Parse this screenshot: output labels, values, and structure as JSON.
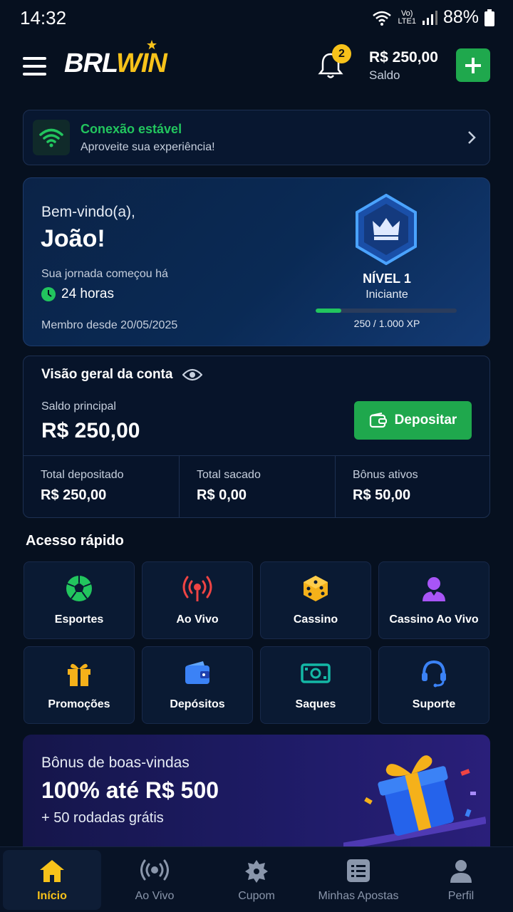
{
  "status_bar": {
    "time": "14:32",
    "volte_top": "Vo)",
    "volte_bottom": "LTE1",
    "battery": "88%"
  },
  "header": {
    "logo_brl": "BRL",
    "logo_win": "WIN",
    "notification_count": "2",
    "balance": "R$ 250,00",
    "balance_label": "Saldo"
  },
  "connection": {
    "title": "Conexão estável",
    "subtitle": "Aproveite sua experiência!"
  },
  "welcome": {
    "greeting": "Bem-vindo(a),",
    "name": "João!",
    "journey_label": "Sua jornada começou há",
    "journey_time": "24 horas",
    "member_since": "Membro desde 20/05/2025",
    "level_title": "NÍVEL 1",
    "level_name": "Iniciante",
    "xp_text": "250 / 1.000 XP",
    "xp_progress": 0.18
  },
  "account": {
    "title": "Visão geral da conta",
    "main_label": "Saldo principal",
    "main_value": "R$ 250,00",
    "deposit_label": "Depositar",
    "stats": [
      {
        "label": "Total depositado",
        "value": "R$ 250,00"
      },
      {
        "label": "Total sacado",
        "value": "R$ 0,00"
      },
      {
        "label": "Bônus ativos",
        "value": "R$ 50,00"
      }
    ]
  },
  "quick_access": {
    "title": "Acesso rápido",
    "items": [
      {
        "label": "Esportes",
        "icon": "soccer-ball-icon"
      },
      {
        "label": "Ao Vivo",
        "icon": "live-broadcast-icon"
      },
      {
        "label": "Cassino",
        "icon": "dice-icon"
      },
      {
        "label": "Cassino Ao Vivo",
        "icon": "dealer-icon"
      },
      {
        "label": "Promoções",
        "icon": "gift-icon"
      },
      {
        "label": "Depósitos",
        "icon": "wallet-icon"
      },
      {
        "label": "Saques",
        "icon": "cash-icon"
      },
      {
        "label": "Suporte",
        "icon": "headset-icon"
      }
    ]
  },
  "bonus": {
    "subtitle": "Bônus de boas-vindas",
    "title": "100% até R$ 500",
    "extra": "+ 50 rodadas grátis"
  },
  "bottom_nav": {
    "items": [
      {
        "label": "Início",
        "icon": "home-icon",
        "active": true
      },
      {
        "label": "Ao Vivo",
        "icon": "live-icon",
        "active": false
      },
      {
        "label": "Cupom",
        "icon": "coupon-icon",
        "active": false
      },
      {
        "label": "Minhas Apostas",
        "icon": "bets-list-icon",
        "active": false
      },
      {
        "label": "Perfil",
        "icon": "profile-icon",
        "active": false
      }
    ]
  },
  "colors": {
    "background": "#06101f",
    "accent_green": "#1fa84d",
    "accent_yellow": "#f7c21a",
    "success_green": "#22c55e"
  }
}
